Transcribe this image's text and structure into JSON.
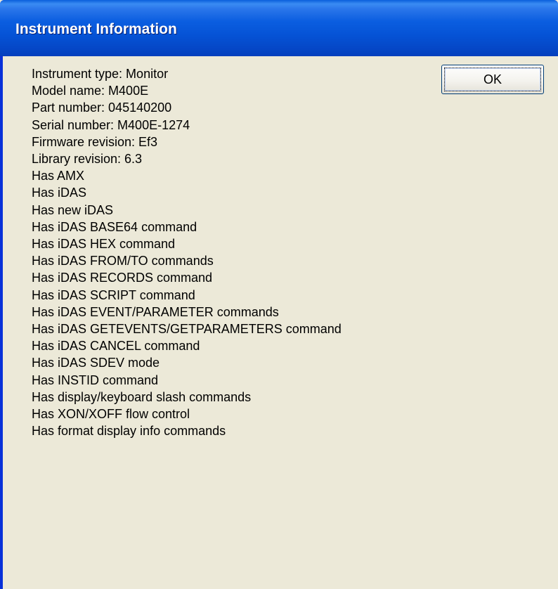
{
  "window": {
    "title": "Instrument Information"
  },
  "buttons": {
    "ok_label": "OK"
  },
  "info_lines": [
    "Instrument type: Monitor",
    "Model name: M400E",
    "Part number: 045140200",
    "Serial number: M400E-1274",
    "Firmware revision: Ef3",
    "Library revision: 6.3",
    "Has AMX",
    "Has iDAS",
    "Has new iDAS",
    "Has iDAS BASE64 command",
    "Has iDAS HEX command",
    "Has iDAS FROM/TO commands",
    "Has iDAS RECORDS command",
    "Has iDAS SCRIPT command",
    "Has iDAS EVENT/PARAMETER commands",
    "Has iDAS GETEVENTS/GETPARAMETERS command",
    "Has iDAS CANCEL command",
    "Has iDAS SDEV mode",
    "Has INSTID command",
    "Has display/keyboard slash commands",
    "Has XON/XOFF flow control",
    "Has format display info commands"
  ],
  "colors": {
    "titlebar": "#0553d6",
    "titlebar_text": "#ffffff",
    "dialog_face": "#ece9d8",
    "button_border": "#003c74"
  }
}
